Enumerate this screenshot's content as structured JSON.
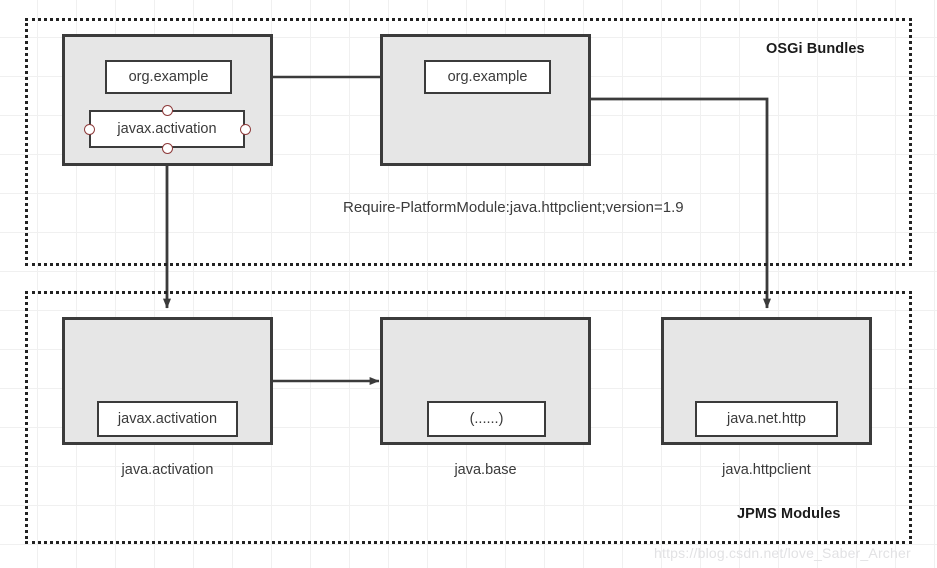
{
  "diagram": {
    "title_top": "OSGi Bundles",
    "title_bottom": "JPMS Modules",
    "note": "Require-PlatformModule:java.httpclient;version=1.9",
    "watermark": "https://blog.csdn.net/love_Saber_Archer",
    "colors": {
      "unit_fill": "#e6e6e6",
      "unit_stroke": "#3b3b3b",
      "pkg_fill": "#ffffff",
      "pkg_stroke": "#3b3b3b",
      "connector": "#3b3b3b",
      "port_stroke": "#8e3b3b",
      "group_stroke": "#222222",
      "grid": "#f0f0f0",
      "text": "#3a3a3a",
      "watermark": "#e2e2e4"
    }
  },
  "osgi": {
    "label": "OSGi Bundles",
    "bundles": [
      {
        "id": "bundle-one",
        "packages": [
          {
            "id": "bundle-one-org-example",
            "label": "org.example"
          },
          {
            "id": "bundle-one-javax-activation",
            "label": "javax.activation",
            "ports": [
              "top",
              "bottom",
              "left",
              "right"
            ]
          }
        ]
      },
      {
        "id": "bundle-two",
        "packages": [
          {
            "id": "bundle-two-org-example",
            "label": "org.example"
          }
        ]
      }
    ],
    "note": "Require-PlatformModule:java.httpclient;version=1.9"
  },
  "jpms": {
    "label": "JPMS Modules",
    "modules": [
      {
        "id": "module-java-activation",
        "caption": "java.activation",
        "package_label": "javax.activation"
      },
      {
        "id": "module-java-base",
        "caption": "java.base",
        "package_label": "(......)"
      },
      {
        "id": "module-java-httpclient",
        "caption": "java.httpclient",
        "package_label": "java.net.http"
      }
    ]
  },
  "connections": [
    {
      "id": "conn-bundle1-to-bundle2",
      "from": "bundle-one-org-example",
      "to": "bundle-two-org-example",
      "style": "arrow"
    },
    {
      "id": "conn-javax-activation-to-module",
      "from": "bundle-one-javax-activation",
      "to": "module-java-activation",
      "style": "arrow"
    },
    {
      "id": "conn-bundle2-to-httpclient",
      "from": "bundle-two",
      "to": "module-java-httpclient",
      "style": "elbow-arrow"
    },
    {
      "id": "conn-activation-to-base",
      "from": "module-java-activation",
      "to": "module-java-base",
      "style": "arrow"
    }
  ]
}
